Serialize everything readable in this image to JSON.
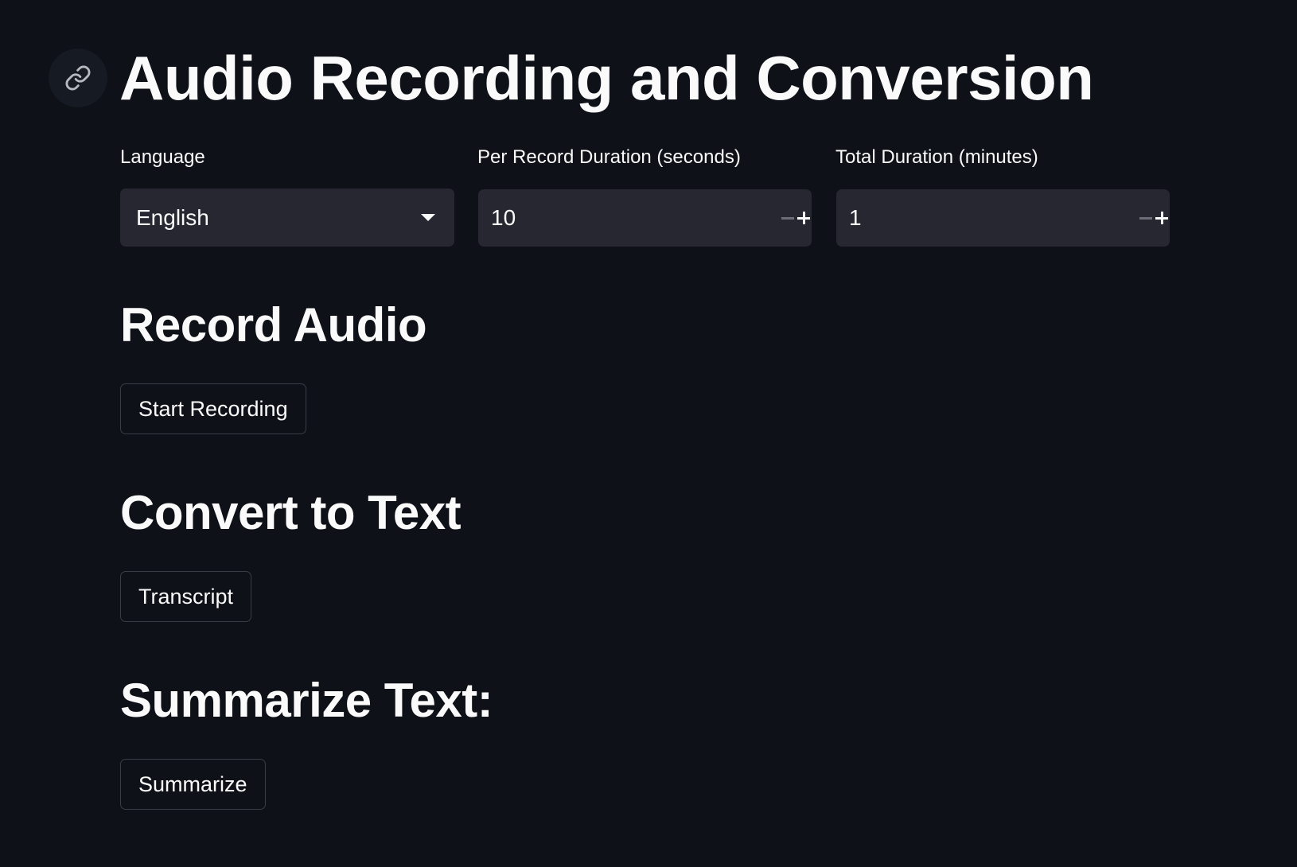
{
  "title": "Audio Recording and Conversion",
  "settings": {
    "language": {
      "label": "Language",
      "selected": "English"
    },
    "per_record_duration": {
      "label": "Per Record Duration (seconds)",
      "value": "10"
    },
    "total_duration": {
      "label": "Total Duration (minutes)",
      "value": "1"
    }
  },
  "sections": {
    "record": {
      "heading": "Record Audio",
      "button_label": "Start Recording"
    },
    "convert": {
      "heading": "Convert to Text",
      "button_label": "Transcript"
    },
    "summarize": {
      "heading": "Summarize Text:",
      "button_label": "Summarize"
    }
  },
  "colors": {
    "background": "#0e1117",
    "input_background": "#262730",
    "text": "#fafafa",
    "button_border": "#3a3d45"
  },
  "icons": {
    "anchor": "link-icon",
    "dropdown": "chevron-down-icon",
    "decrement": "minus-icon",
    "increment": "plus-icon"
  }
}
